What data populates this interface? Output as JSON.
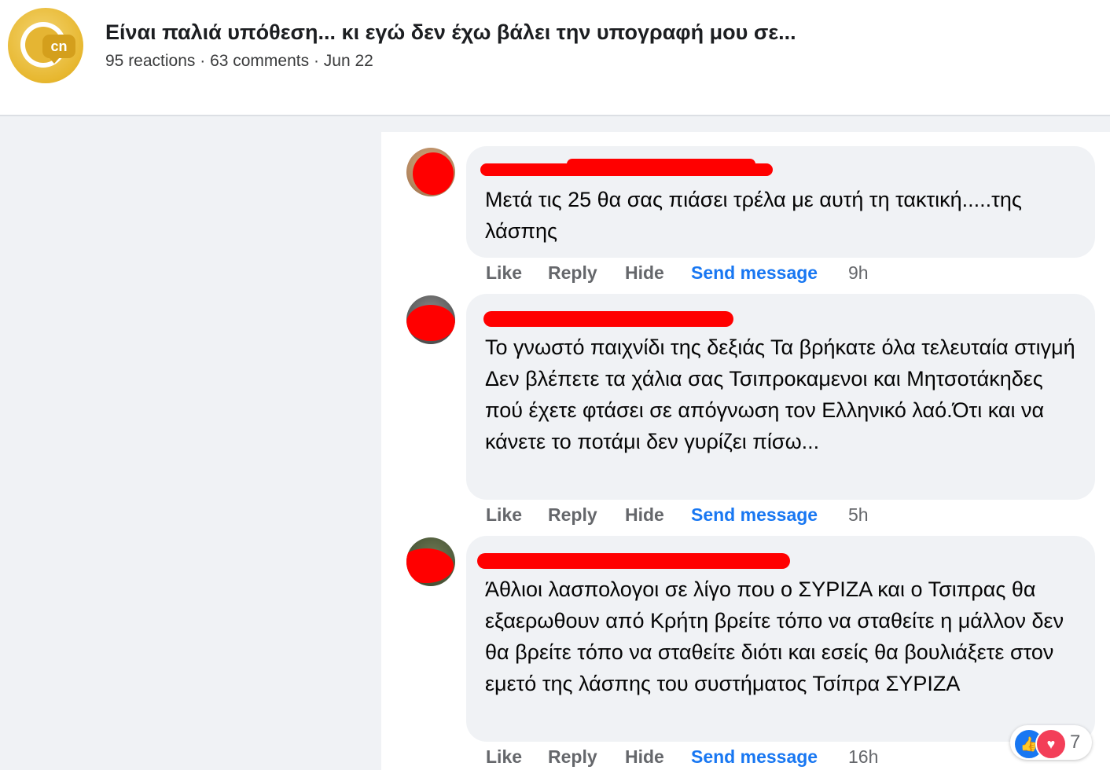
{
  "post": {
    "page_logo_text": "cn",
    "title": "Είναι παλιά υπόθεση... κι εγώ δεν έχω βάλει την υπογραφή μου σε...",
    "meta": "95 reactions · 63 comments · Jun 22"
  },
  "comment_actions": {
    "like": "Like",
    "reply": "Reply",
    "hide": "Hide",
    "send_message": "Send message"
  },
  "comments": [
    {
      "author": "[redacted]",
      "text": "Μετά τις 25 θα σας πιάσει τρέλα με αυτή τη τακτική.....της λάσπης",
      "time": "9h"
    },
    {
      "author": "[redacted]",
      "text": "Το γνωστό παιχνίδι της δεξιάς Τα βρήκατε όλα τελευταία στιγμή Δεν βλέπετε τα χάλια σας Τσιπροκαμενοι και Μητσοτάκηδες πού έχετε φτάσει σε απόγνωση τον Ελληνικό λαό.Ότι και να κάνετε το ποτάμι δεν γυρίζει πίσω...",
      "time": "5h"
    },
    {
      "author": "[redacted]",
      "text": "Άθλιοι λασπολογοι σε λίγο που ο ΣΥΡΙΖΑ και ο Τσιπρας θα εξαερωθουν από Κρήτη βρείτε τόπο να σταθείτε η μάλλον δεν θα βρείτε τόπο να σταθείτε διότι και εσείς θα βουλιάξετε στον εμετό της λάσπης του συστήματος Τσίπρα ΣΥΡΙΖΑ",
      "time": "16h",
      "reaction_count": "7",
      "reaction_icons": [
        "like-icon",
        "love-icon"
      ]
    }
  ],
  "colors": {
    "link_blue": "#1877f2",
    "redaction": "#ff0000",
    "bubble_bg": "#f0f2f5",
    "page_bg": "#f0f2f5"
  }
}
